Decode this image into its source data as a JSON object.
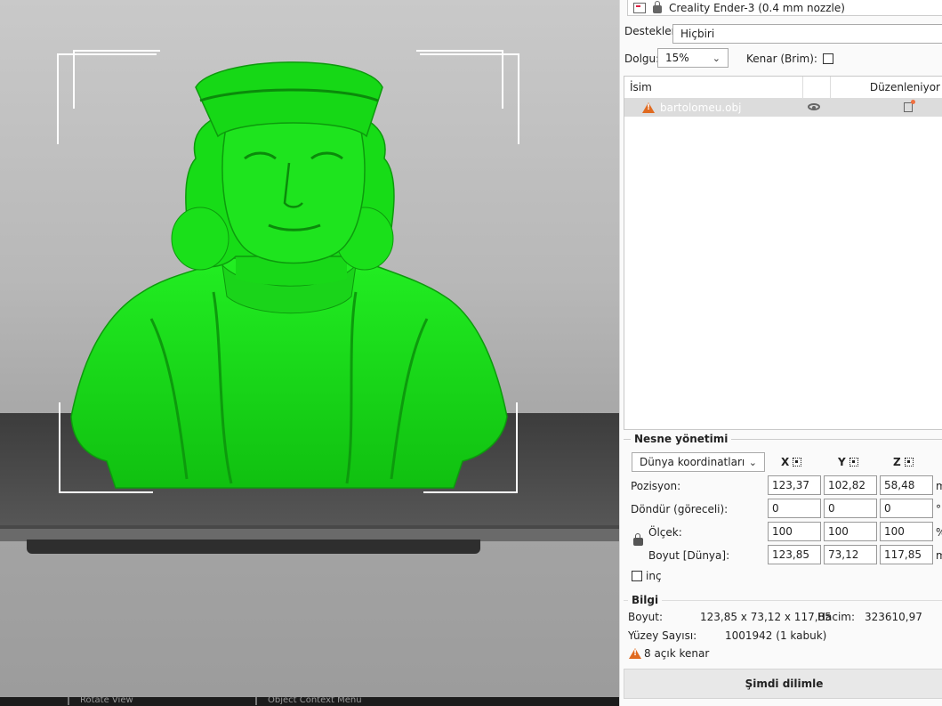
{
  "viewport": {
    "model_color": "#15e015",
    "status_items": [
      "Rotate View",
      "Object Context Menu"
    ]
  },
  "panel": {
    "printer_name": "Creality Ender-3 (0.4 mm nozzle)",
    "supports_label": "Destekler:",
    "supports_value": "Hiçbiri",
    "infill_label": "Dolgu:",
    "infill_value": "15%",
    "brim_label": "Kenar (Brim):",
    "object_list": {
      "col_name": "İsim",
      "col_editing": "Düzenleniyor",
      "items": [
        {
          "name": "bartolomeu.obj",
          "warning": true
        }
      ]
    },
    "object_manipulation": {
      "title": "Nesne yönetimi",
      "coord_system": "Dünya koordinatları",
      "axes": [
        "X",
        "Y",
        "Z"
      ],
      "rows": [
        {
          "label": "Pozisyon:",
          "values": [
            "123,37",
            "102,82",
            "58,48"
          ],
          "unit": "m"
        },
        {
          "label": "Döndür (göreceli):",
          "values": [
            "0",
            "0",
            "0"
          ],
          "unit": "°"
        },
        {
          "label": "Ölçek:",
          "values": [
            "100",
            "100",
            "100"
          ],
          "unit": "%"
        },
        {
          "label": "Boyut [Dünya]:",
          "values": [
            "123,85",
            "73,12",
            "117,85"
          ],
          "unit": "m"
        }
      ],
      "inches_label": "inç"
    },
    "info": {
      "title": "Bilgi",
      "size_label": "Boyut:",
      "size_value": "123,85 x 73,12 x 117,85",
      "volume_label": "Hacim:",
      "volume_value": "323610,97",
      "facets_label": "Yüzey Sayısı:",
      "facets_value": "1001942 (1 kabuk)",
      "open_edges": "8 açık kenar"
    },
    "slice_button": "Şimdi dilimle"
  }
}
